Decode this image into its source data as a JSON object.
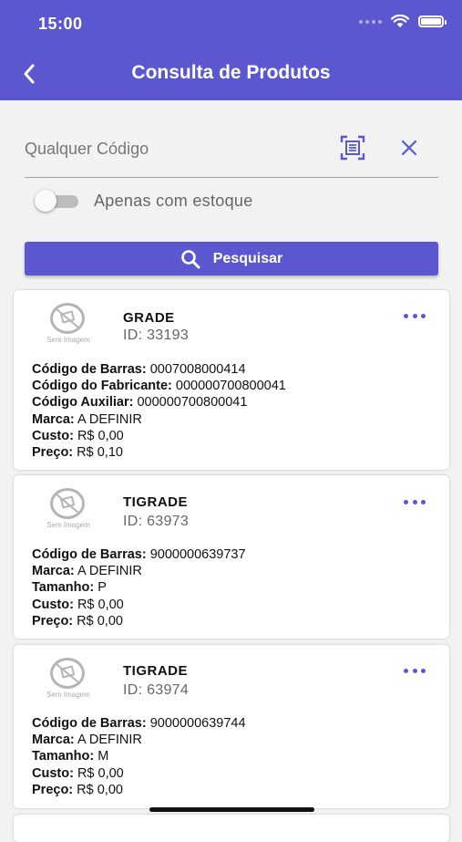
{
  "status_bar": {
    "time": "15:00"
  },
  "header": {
    "title": "Consulta de Produtos",
    "back_icon": "chevron-left-icon"
  },
  "search": {
    "placeholder": "Qualquer Código",
    "value": "",
    "scan_icon": "barcode-scan-icon",
    "clear_icon": "close-icon"
  },
  "filter": {
    "label": "Apenas com estoque",
    "in_stock_only": false
  },
  "search_button": {
    "label": "Pesquisar",
    "icon": "search-icon"
  },
  "theme": {
    "accent": "#5b58cf",
    "background": "#f2f2f2"
  },
  "products": [
    {
      "name": "GRADE",
      "id": "ID: 33193",
      "image_caption": "Sem Imagem",
      "fields": [
        {
          "label": "Código de Barras:",
          "value": "0007008000414"
        },
        {
          "label": "Código do Fabricante:",
          "value": "000000700800041"
        },
        {
          "label": "Código Auxiliar:",
          "value": "000000700800041"
        },
        {
          "label": "Marca:",
          "value": "A DEFINIR"
        },
        {
          "label": "Custo:",
          "value": "R$ 0,00"
        },
        {
          "label": "Preço:",
          "value": "R$ 0,10"
        }
      ]
    },
    {
      "name": "TIGRADE",
      "id": "ID: 63973",
      "image_caption": "Sem Imagem",
      "fields": [
        {
          "label": "Código de Barras:",
          "value": "9000000639737"
        },
        {
          "label": "Marca:",
          "value": "A DEFINIR"
        },
        {
          "label": "Tamanho:",
          "value": "P"
        },
        {
          "label": "Custo:",
          "value": "R$ 0,00"
        },
        {
          "label": "Preço:",
          "value": "R$ 0,00"
        }
      ]
    },
    {
      "name": "TIGRADE",
      "id": "ID: 63974",
      "image_caption": "Sem Imagem",
      "fields": [
        {
          "label": "Código de Barras:",
          "value": "9000000639744"
        },
        {
          "label": "Marca:",
          "value": "A DEFINIR"
        },
        {
          "label": "Tamanho:",
          "value": "M"
        },
        {
          "label": "Custo:",
          "value": "R$ 0,00"
        },
        {
          "label": "Preço:",
          "value": "R$ 0,00"
        }
      ]
    }
  ]
}
